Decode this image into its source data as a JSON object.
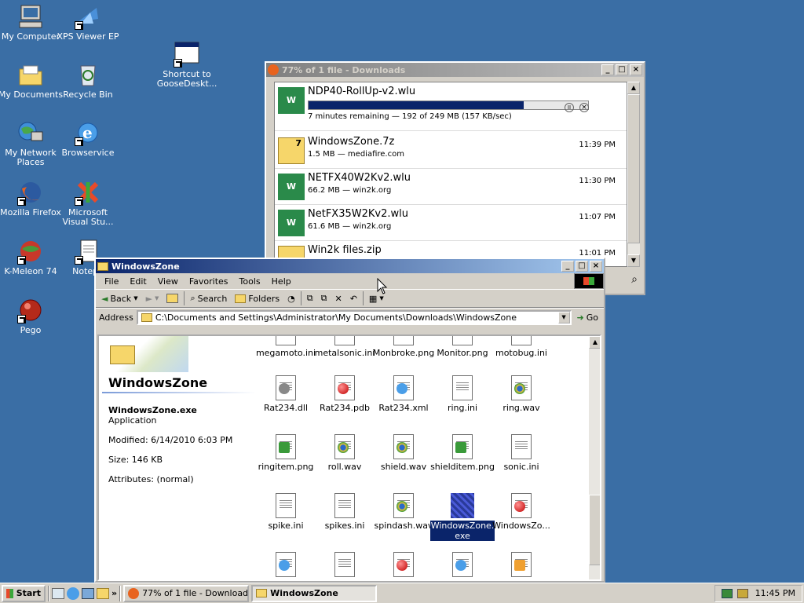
{
  "desktop": {
    "icons": [
      {
        "label": "My Computer"
      },
      {
        "label": "XPS Viewer EP"
      },
      {
        "label": "Shortcut to\nGooseDeskt..."
      },
      {
        "label": "My Documents"
      },
      {
        "label": "Recycle Bin"
      },
      {
        "label": "My Network\nPlaces"
      },
      {
        "label": "Browservice"
      },
      {
        "label": "Mozilla Firefox"
      },
      {
        "label": "Microsoft\nVisual Stu..."
      },
      {
        "label": "K-Meleon 74"
      },
      {
        "label": "Notepa"
      },
      {
        "label": "Pego"
      }
    ]
  },
  "downloads": {
    "title": "77% of 1 file - Downloads",
    "active": {
      "name": "NDP40-RollUp-v2.wlu",
      "progress": 0.77,
      "status": "7 minutes remaining — 192 of 249 MB (157 KB/sec)"
    },
    "items": [
      {
        "name": "WindowsZone.7z",
        "meta": "1.5 MB — mediafire.com",
        "time": "11:39 PM"
      },
      {
        "name": "NETFX40W2Kv2.wlu",
        "meta": "66.2 MB — win2k.org",
        "time": "11:30 PM"
      },
      {
        "name": "NetFX35W2Kv2.wlu",
        "meta": "61.6 MB — win2k.org",
        "time": "11:07 PM"
      },
      {
        "name": "Win2k files.zip",
        "meta": "",
        "time": "11:01 PM"
      }
    ]
  },
  "explorer": {
    "title": "WindowsZone",
    "menu": [
      "File",
      "Edit",
      "View",
      "Favorites",
      "Tools",
      "Help"
    ],
    "toolbar": {
      "back": "Back",
      "search": "Search",
      "folders": "Folders"
    },
    "address_label": "Address",
    "address": "C:\\Documents and Settings\\Administrator\\My Documents\\Downloads\\WindowsZone",
    "go": "Go",
    "panel": {
      "folder": "WindowsZone",
      "file": "WindowsZone.exe",
      "type": "Application",
      "modified": "Modified: 6/14/2010 6:03 PM",
      "size": "Size: 146 KB",
      "attributes": "Attributes: (normal)"
    },
    "files": [
      {
        "label": "megamoto.ini"
      },
      {
        "label": "metalsonic.ini"
      },
      {
        "label": "Monbroke.png"
      },
      {
        "label": "Monitor.png"
      },
      {
        "label": "motobug.ini"
      },
      {
        "label": "Rat234.dll"
      },
      {
        "label": "Rat234.pdb"
      },
      {
        "label": "Rat234.xml"
      },
      {
        "label": "ring.ini"
      },
      {
        "label": "ring.wav"
      },
      {
        "label": "ringitem.png"
      },
      {
        "label": "roll.wav"
      },
      {
        "label": "shield.wav"
      },
      {
        "label": "shielditem.png"
      },
      {
        "label": "sonic.ini"
      },
      {
        "label": "spike.ini"
      },
      {
        "label": "spikes.ini"
      },
      {
        "label": "spindash.wav"
      },
      {
        "label": "WindowsZone.\nexe"
      },
      {
        "label": "WindowsZo..."
      }
    ]
  },
  "taskbar": {
    "start": "Start",
    "buttons": [
      {
        "label": "77% of 1 file - Downloads"
      },
      {
        "label": "WindowsZone"
      }
    ],
    "clock": "11:45 PM"
  }
}
